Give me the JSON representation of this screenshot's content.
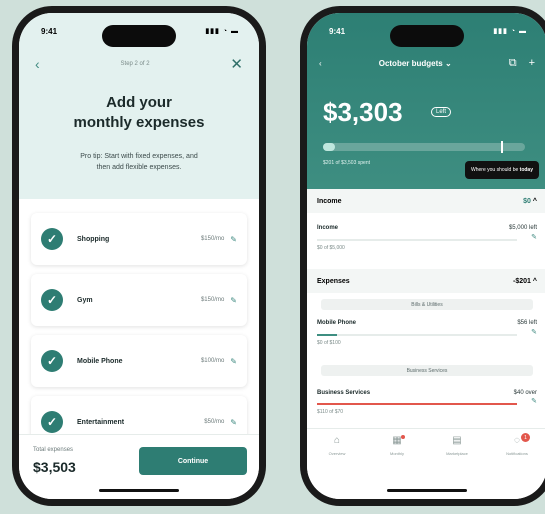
{
  "left_phone": {
    "status_time": "9:41",
    "status_icons": "▮▮▮ ◔ ▬",
    "step": "Step 2 of 2",
    "back_icon": "‹",
    "close_icon": "✕",
    "title_line1": "Add your",
    "title_line2": "monthly expenses",
    "tip_line1": "Pro tip: Start with fixed expenses, and",
    "tip_line2": "then add flexible expenses.",
    "expenses": [
      {
        "name": "Shopping",
        "amount": "$150/mo"
      },
      {
        "name": "Gym",
        "amount": "$150/mo"
      },
      {
        "name": "Mobile Phone",
        "amount": "$100/mo"
      },
      {
        "name": "Entertainment",
        "amount": "$50/mo"
      }
    ],
    "total_label": "Total expenses",
    "total_value": "$3,503",
    "continue_label": "Continue"
  },
  "right_phone": {
    "status_time": "9:41",
    "status_icons": "▮▮▮ ◔ ▬",
    "nav_title": "October budgets ⌄",
    "amount": "$3,303",
    "left_pill": "Left",
    "spent_text": "$201 of $3,503 spent",
    "progress_fraction": 0.06,
    "today_fraction": 0.88,
    "tooltip_prefix": "Where you should be",
    "tooltip_bold": "today",
    "income": {
      "header": "Income",
      "header_value": "$0",
      "row_title": "Income",
      "row_right": "$5,000 left",
      "row_sub": "$0 of $5,000",
      "fraction": 0.0
    },
    "expenses": {
      "header": "Expenses",
      "header_value": "-$201",
      "cat1": "Bills & Utilities",
      "row1_title": "Mobile Phone",
      "row1_right": "$56 left",
      "row1_sub": "$0 of $100",
      "row1_fraction": 0.1,
      "cat2": "Business Services",
      "row2_title": "Business Services",
      "row2_right": "$40 over",
      "row2_sub": "$110 of $70",
      "row2_fraction": 1.0
    },
    "tabs": [
      {
        "label": "Overview",
        "icon": "⌂"
      },
      {
        "label": "Monthly",
        "icon": "▦"
      },
      {
        "label": "Marketplace",
        "icon": "▤"
      },
      {
        "label": "Notifications",
        "icon": "◌",
        "badge": "1"
      }
    ],
    "colors": {
      "accent": "#2e7d73",
      "over": "#e2574c"
    }
  }
}
